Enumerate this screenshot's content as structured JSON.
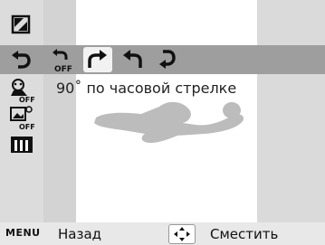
{
  "caption": "90˚ по часовой стрелке",
  "footer": {
    "menu_badge": "MENU",
    "back_label": "Назад",
    "move_label": "Сместить"
  },
  "icons": {
    "left_column": [
      "crop-icon",
      "rotate-icon",
      "face-retouch-off-icon",
      "red-eye-fix-off-icon",
      "color-adjust-icon"
    ],
    "rotate_options": [
      "rotate-off-icon",
      "rotate-right-90-icon",
      "rotate-left-90-icon",
      "rotate-180-icon"
    ],
    "move": "four-way-arrow-icon"
  },
  "colors": {
    "selection_row": "#9e9e9e",
    "selected_option": "#f2f2f2",
    "silhouette": "#bcbcbc"
  }
}
